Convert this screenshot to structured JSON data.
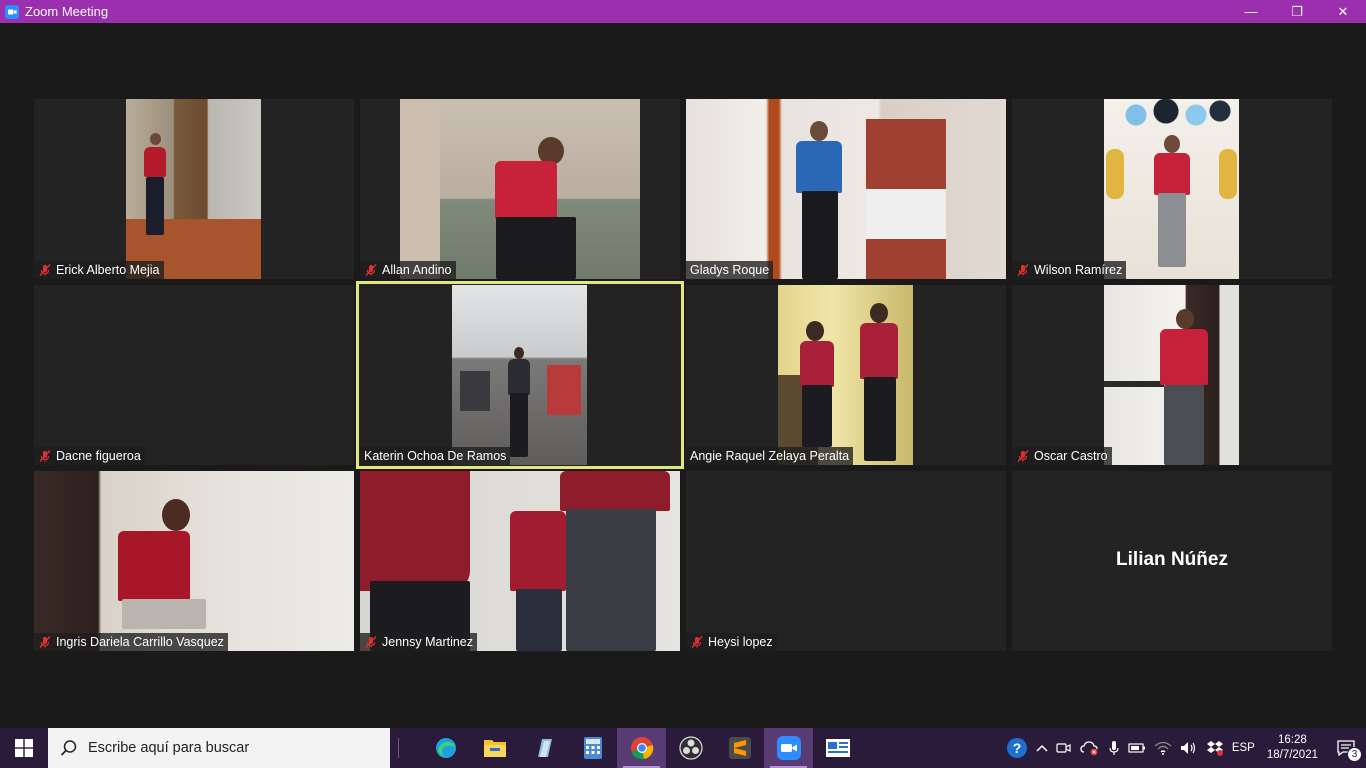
{
  "window": {
    "title": "Zoom Meeting",
    "controls": {
      "minimize": "—",
      "restore": "❐",
      "close": "✕"
    }
  },
  "participants": [
    {
      "name": "Erick Alberto Mejia",
      "muted": true
    },
    {
      "name": "Allan Andino",
      "muted": true
    },
    {
      "name": "Gladys Roque",
      "muted": false
    },
    {
      "name": "Wilson Ramírez",
      "muted": true
    },
    {
      "name": "Dacne figueroa",
      "muted": true
    },
    {
      "name": "Katerin Ochoa De Ramos",
      "muted": false,
      "active_speaker": true
    },
    {
      "name": "Angie Raquel Zelaya Peralta",
      "muted": false
    },
    {
      "name": "Oscar Castro",
      "muted": true
    },
    {
      "name": "Ingris Dariela Carrillo Vasquez",
      "muted": true
    },
    {
      "name": "Jennsy Martinez",
      "muted": true
    },
    {
      "name": "Heysi lopez",
      "muted": true
    },
    {
      "name": "Lilian Núñez",
      "video_off": true
    }
  ],
  "taskbar": {
    "search_placeholder": "Escribe aquí para buscar",
    "apps": [
      "edge-icon",
      "file-explorer-icon",
      "notes-icon",
      "calculator-icon",
      "chrome-icon",
      "obs-icon",
      "sublime-icon",
      "zoom-icon",
      "news-icon"
    ],
    "tray": {
      "language": "ESP",
      "time": "16:28",
      "date": "18/7/2021",
      "notification_count": "3"
    }
  },
  "colors": {
    "titlebar": "#9b2fae",
    "taskbar": "#2a1b3b",
    "active_speaker_border": "#e0e87a",
    "muted_icon": "#e02f2f"
  }
}
